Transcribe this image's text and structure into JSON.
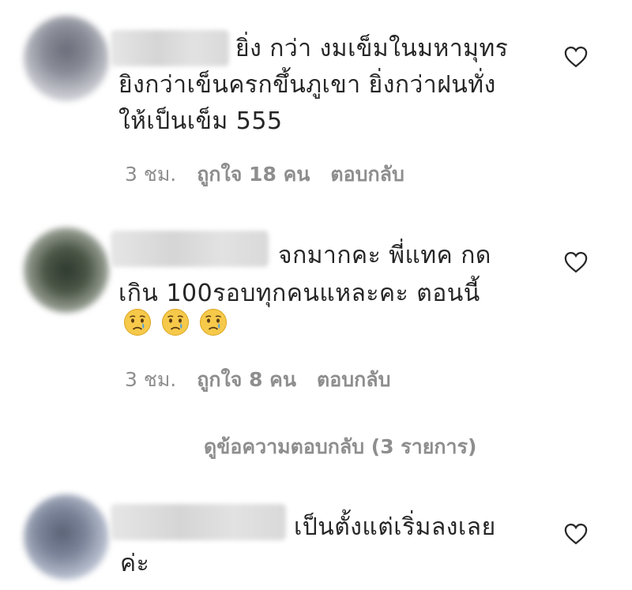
{
  "comments": [
    {
      "lines": [
        "ยิ่ง กว่า งมเข็มในมหามุทร",
        "ยิงกว่าเข็นครกขึ้นภูเขา ยิ่งกว่าฝนทั่ง",
        "ให้เป็นเข็ม 555"
      ],
      "time": "3 ชม.",
      "likes": "ถูกใจ 18 คน",
      "reply": "ตอบกลับ"
    },
    {
      "lines": [
        "จกมากคะ พี่แทค กด",
        "เกิน 100รอบทุกคนแหละคะ ตอนนี้"
      ],
      "emoji": [
        "crying-face-emoji",
        "crying-face-emoji",
        "crying-face-emoji"
      ],
      "time": "3 ชม.",
      "likes": "ถูกใจ 8 คน",
      "reply": "ตอบกลับ",
      "view_replies": "ดูข้อความตอบกลับ (3 รายการ)"
    },
    {
      "lines": [
        "เป็นตั้งแต่เริ่มลงเลย",
        "ค่ะ"
      ]
    }
  ],
  "colors": {
    "text": "#262626",
    "meta": "#8e8e8e",
    "heart_outline": "#262626"
  }
}
